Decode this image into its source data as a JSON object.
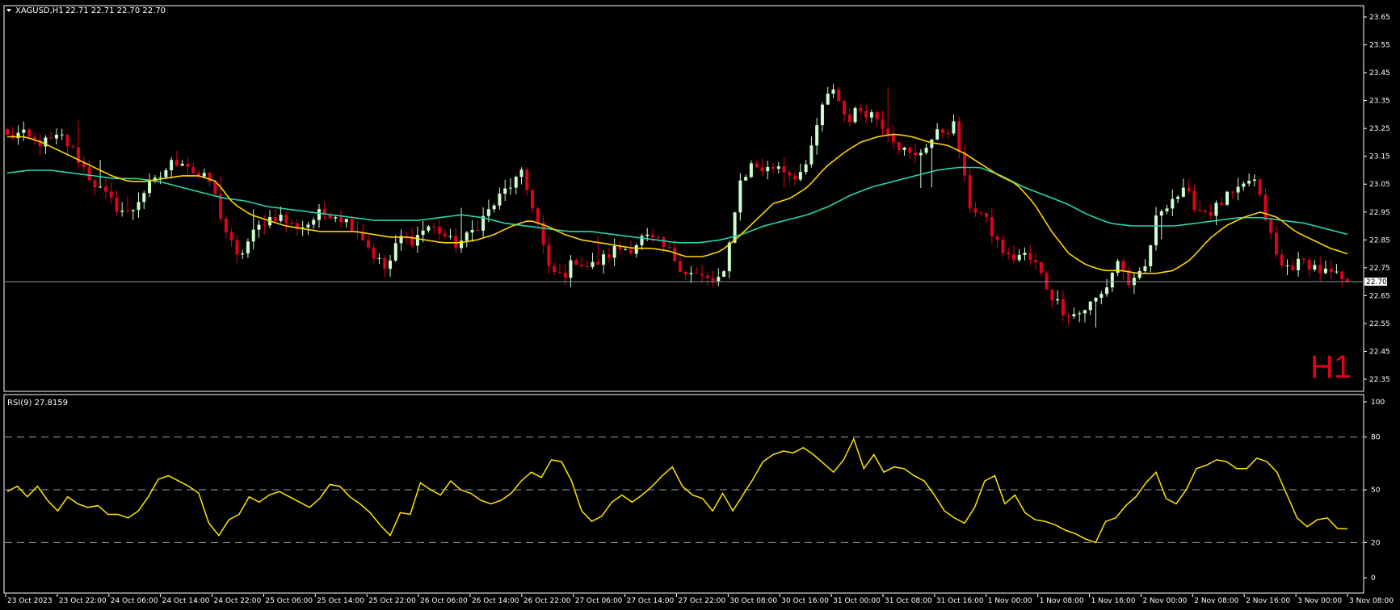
{
  "header": {
    "symbol": "XAGUSD,H1",
    "ohlc": "22.71 22.71 22.70 22.70"
  },
  "timeframe_label": "H1",
  "rsi_header": "RSI(9) 27.8159",
  "current_price_label": "22.70",
  "colors": {
    "background": "#000000",
    "bull": "#ccffcc",
    "bear": "#e0001a",
    "ma_fast": "#ffd400",
    "ma_slow": "#26d6b0",
    "rsi": "#ffe600",
    "timeframe": "#e0001a",
    "grid_text": "#ffffff"
  },
  "chart_data": [
    {
      "type": "candlestick",
      "title": "XAGUSD,H1",
      "ylim": [
        22.3,
        23.7
      ],
      "y_ticks": [
        "23.65",
        "23.55",
        "23.45",
        "23.35",
        "23.25",
        "23.15",
        "23.05",
        "22.95",
        "22.85",
        "22.75",
        "22.65",
        "22.55",
        "22.45",
        "22.35"
      ],
      "x_ticks": [
        "23 Oct 2023",
        "23 Oct 22:00",
        "24 Oct 06:00",
        "24 Oct 14:00",
        "24 Oct 22:00",
        "25 Oct 06:00",
        "25 Oct 14:00",
        "25 Oct 22:00",
        "26 Oct 06:00",
        "26 Oct 14:00",
        "26 Oct 22:00",
        "27 Oct 06:00",
        "27 Oct 14:00",
        "27 Oct 22:00",
        "30 Oct 08:00",
        "30 Oct 16:00",
        "31 Oct 00:00",
        "31 Oct 08:00",
        "31 Oct 16:00",
        "1 Nov 00:00",
        "1 Nov 08:00",
        "1 Nov 16:00",
        "2 Nov 00:00",
        "2 Nov 08:00",
        "2 Nov 16:00",
        "3 Nov 00:00",
        "3 Nov 08:00"
      ],
      "current_price": 22.7,
      "close_anchors": [
        23.22,
        23.23,
        23.2,
        23.2,
        23.22,
        23.16,
        23.08,
        23.02,
        22.97,
        22.94,
        23.02,
        23.06,
        23.12,
        23.14,
        23.08,
        23.06,
        22.9,
        22.78,
        22.86,
        22.92,
        22.94,
        22.9,
        22.9,
        22.94,
        22.95,
        22.92,
        22.88,
        22.8,
        22.74,
        22.86,
        22.85,
        22.9,
        22.88,
        22.83,
        22.86,
        22.92,
        22.98,
        23.04,
        23.08,
        22.95,
        22.74,
        22.72,
        22.78,
        22.75,
        22.78,
        22.82,
        22.82,
        22.86,
        22.84,
        22.8,
        22.74,
        22.72,
        22.7,
        22.72,
        23.05,
        23.12,
        23.1,
        23.12,
        23.08,
        23.1,
        23.3,
        23.4,
        23.28,
        23.32,
        23.3,
        23.25,
        23.18,
        23.14,
        23.2,
        23.24,
        23.26,
        22.98,
        22.94,
        22.85,
        22.78,
        22.8,
        22.76,
        22.66,
        22.6,
        22.58,
        22.62,
        22.66,
        22.78,
        22.68,
        22.74,
        22.95,
        23.0,
        23.02,
        22.96,
        22.95,
        23.0,
        23.02,
        23.08,
        22.92,
        22.75,
        22.76,
        22.77,
        22.74,
        22.72,
        22.7
      ],
      "ma_fast_anchors": [
        23.22,
        23.22,
        23.2,
        23.17,
        23.14,
        23.11,
        23.08,
        23.06,
        23.06,
        23.07,
        23.08,
        23.08,
        23.06,
        22.98,
        22.94,
        22.92,
        22.9,
        22.89,
        22.88,
        22.88,
        22.88,
        22.87,
        22.86,
        22.86,
        22.85,
        22.84,
        22.84,
        22.85,
        22.87,
        22.9,
        22.92,
        22.9,
        22.87,
        22.85,
        22.84,
        22.83,
        22.82,
        22.82,
        22.81,
        22.79,
        22.79,
        22.81,
        22.86,
        22.92,
        22.98,
        23.0,
        23.04,
        23.11,
        23.16,
        23.2,
        23.22,
        23.23,
        23.22,
        23.2,
        23.19,
        23.16,
        23.12,
        23.08,
        23.05,
        22.98,
        22.88,
        22.8,
        22.76,
        22.74,
        22.74,
        22.73,
        22.73,
        22.74,
        22.78,
        22.85,
        22.9,
        22.93,
        22.95,
        22.93,
        22.88,
        22.85,
        22.82,
        22.8
      ],
      "ma_slow_anchors": [
        23.09,
        23.1,
        23.1,
        23.09,
        23.08,
        23.07,
        23.07,
        23.06,
        23.04,
        23.02,
        23.0,
        22.99,
        22.97,
        22.96,
        22.95,
        22.94,
        22.93,
        22.92,
        22.92,
        22.92,
        22.93,
        22.94,
        22.93,
        22.91,
        22.9,
        22.89,
        22.88,
        22.88,
        22.87,
        22.86,
        22.85,
        22.84,
        22.84,
        22.85,
        22.87,
        22.9,
        22.92,
        22.94,
        22.97,
        23.01,
        23.04,
        23.06,
        23.08,
        23.1,
        23.11,
        23.11,
        23.08,
        23.04,
        23.01,
        22.98,
        22.94,
        22.91,
        22.9,
        22.9,
        22.9,
        22.91,
        22.92,
        22.93,
        22.93,
        22.92,
        22.91,
        22.89,
        22.87
      ]
    },
    {
      "type": "line",
      "title": "RSI(9) 27.8159",
      "ylim": [
        0,
        100
      ],
      "y_ticks": [
        "100",
        "80",
        "50",
        "20",
        "0"
      ],
      "levels": [
        80,
        50,
        20
      ],
      "values": [
        49,
        52,
        46,
        52,
        44,
        38,
        46,
        42,
        40,
        41,
        36,
        36,
        34,
        38,
        46,
        56,
        58,
        55,
        52,
        48,
        31,
        24,
        33,
        36,
        46,
        43,
        47,
        49,
        46,
        43,
        40,
        45,
        53,
        52,
        46,
        42,
        37,
        30,
        24,
        37,
        36,
        54,
        50,
        47,
        55,
        50,
        48,
        44,
        42,
        44,
        48,
        55,
        60,
        57,
        67,
        66,
        55,
        38,
        32,
        35,
        43,
        47,
        43,
        47,
        52,
        58,
        63,
        52,
        47,
        45,
        38,
        48,
        38,
        47,
        56,
        66,
        70,
        72,
        71,
        74,
        70,
        65,
        60,
        67,
        79,
        62,
        70,
        60,
        63,
        62,
        58,
        55,
        47,
        38,
        34,
        31,
        40,
        55,
        58,
        42,
        47,
        37,
        33,
        32,
        30,
        27,
        25,
        22,
        20,
        32,
        34,
        41,
        46,
        54,
        60,
        45,
        42,
        50,
        62,
        64,
        67,
        66,
        62,
        62,
        68,
        66,
        60,
        47,
        34,
        29,
        33,
        34,
        28,
        27.8
      ]
    }
  ]
}
